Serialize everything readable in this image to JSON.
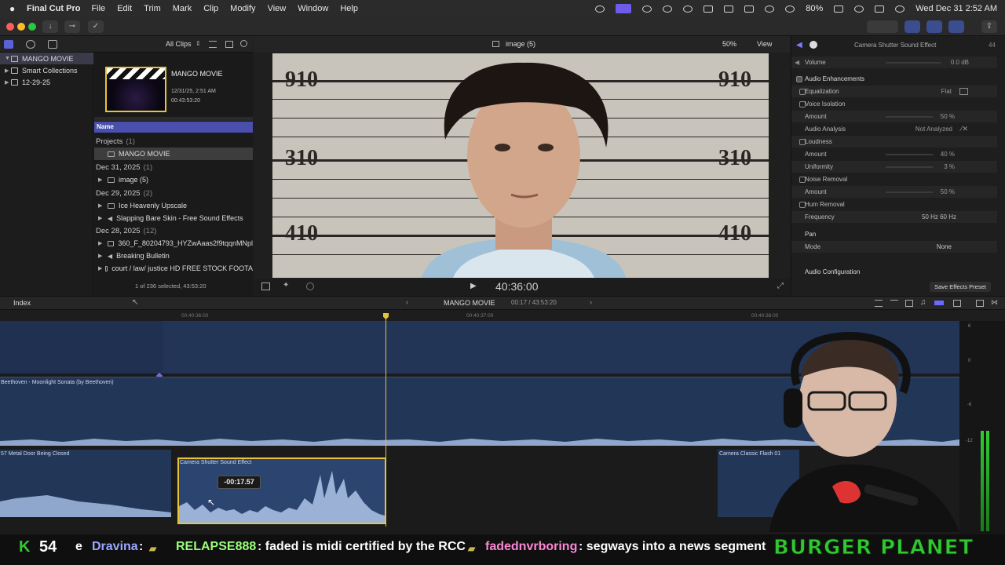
{
  "menubar": {
    "app_name": "Final Cut Pro",
    "items": [
      "File",
      "Edit",
      "Trim",
      "Mark",
      "Clip",
      "Modify",
      "View",
      "Window",
      "Help"
    ],
    "battery": "80%",
    "clock": "Wed Dec 31  2:52 AM"
  },
  "library": {
    "all_clips": "All Clips",
    "rows": [
      {
        "label": "MANGO MOVIE",
        "selected": true
      },
      {
        "label": "Smart Collections"
      },
      {
        "label": "12-29-25"
      }
    ]
  },
  "browser": {
    "project_title": "MANGO MOVIE",
    "project_date": "12/31/25, 2:51 AM",
    "project_duration": "00:43:53:20",
    "name_header": "Name",
    "groups": [
      {
        "label": "Projects",
        "count": "(1)",
        "items": [
          "MANGO MOVIE"
        ]
      },
      {
        "label": "Dec 31, 2025",
        "count": "(1)",
        "items": [
          "image (5)"
        ]
      },
      {
        "label": "Dec 29, 2025",
        "count": "(2)",
        "items": [
          "Ice Heavenly Upscale",
          "Slapping Bare Skin - Free Sound Effects"
        ]
      },
      {
        "label": "Dec 28, 2025",
        "count": "(12)",
        "items": [
          "360_F_80204793_HYZwAaas2f9tqqnMNpl",
          "Breaking Bulletin",
          "court / law/ justice HD FREE STOCK FOOTA"
        ]
      }
    ],
    "selection": "1 of 236 selected, 43:53:20"
  },
  "viewer": {
    "clip_name": "image (5)",
    "zoom": "50%",
    "view_label": "View",
    "timecode": "40:36:00",
    "height_marks": [
      "910",
      "310",
      "410"
    ]
  },
  "inspector": {
    "title": "Camera Shutter Sound Effect",
    "duration_hint": "44",
    "volume_label": "Volume",
    "volume_value": "0.0  dB",
    "section": "Audio Enhancements",
    "rows": [
      {
        "label": "Equalization",
        "value": "Flat",
        "check": true
      },
      {
        "label": "Voice Isolation",
        "value": "",
        "check": true
      },
      {
        "label": "Amount",
        "value": "50  %",
        "check": false
      },
      {
        "label": "Audio Analysis",
        "value": "Not Analyzed",
        "check": false
      },
      {
        "label": "Loudness",
        "value": "",
        "check": true
      },
      {
        "label": "Amount",
        "value": "40  %",
        "check": false
      },
      {
        "label": "Uniformity",
        "value": "3  %",
        "check": false
      },
      {
        "label": "Noise Removal",
        "value": "",
        "check": true
      },
      {
        "label": "Amount",
        "value": "50  %",
        "check": false
      },
      {
        "label": "Hum Removal",
        "value": "",
        "check": true
      },
      {
        "label": "Frequency",
        "value": "50 Hz     60 Hz",
        "check": false
      }
    ],
    "pan_label": "Pan",
    "mode_label": "Mode",
    "mode_value": "None",
    "audio_config": "Audio Configuration",
    "save_preset": "Save Effects Preset"
  },
  "timeline": {
    "index_label": "Index",
    "project_name": "MANGO MOVIE",
    "position": "00:17 / 43:53:20",
    "ruler": [
      "00:40:36:00",
      "00:40:37:00",
      "00:40:38:00"
    ],
    "music_clip": "Beethoven - Moonlight Sonata (by Beethoven)",
    "sfx_clips": [
      "57 Metal Door Being Closed",
      "Camera Shutter Sound Effect",
      "Camera Classic Flash 01"
    ],
    "drag_offset": "-00:17.57",
    "meter_scale": [
      "6",
      "0",
      "-6",
      "-12"
    ]
  },
  "ticker": {
    "k_label": "K",
    "k_count": "54",
    "fragment": "e",
    "user1": "Dravina",
    "sep": ":",
    "user2": "RELAPSE888",
    "msg2": ": faded is midi certified by the RCC",
    "user3": "fadednvrboring",
    "msg3": ": segways into a news segment",
    "brand": "BURGER PLANET"
  },
  "colors": {
    "accent": "#e8c43a",
    "selection": "#4a4fae",
    "track": "#223658",
    "ticker_green": "#32c832"
  }
}
